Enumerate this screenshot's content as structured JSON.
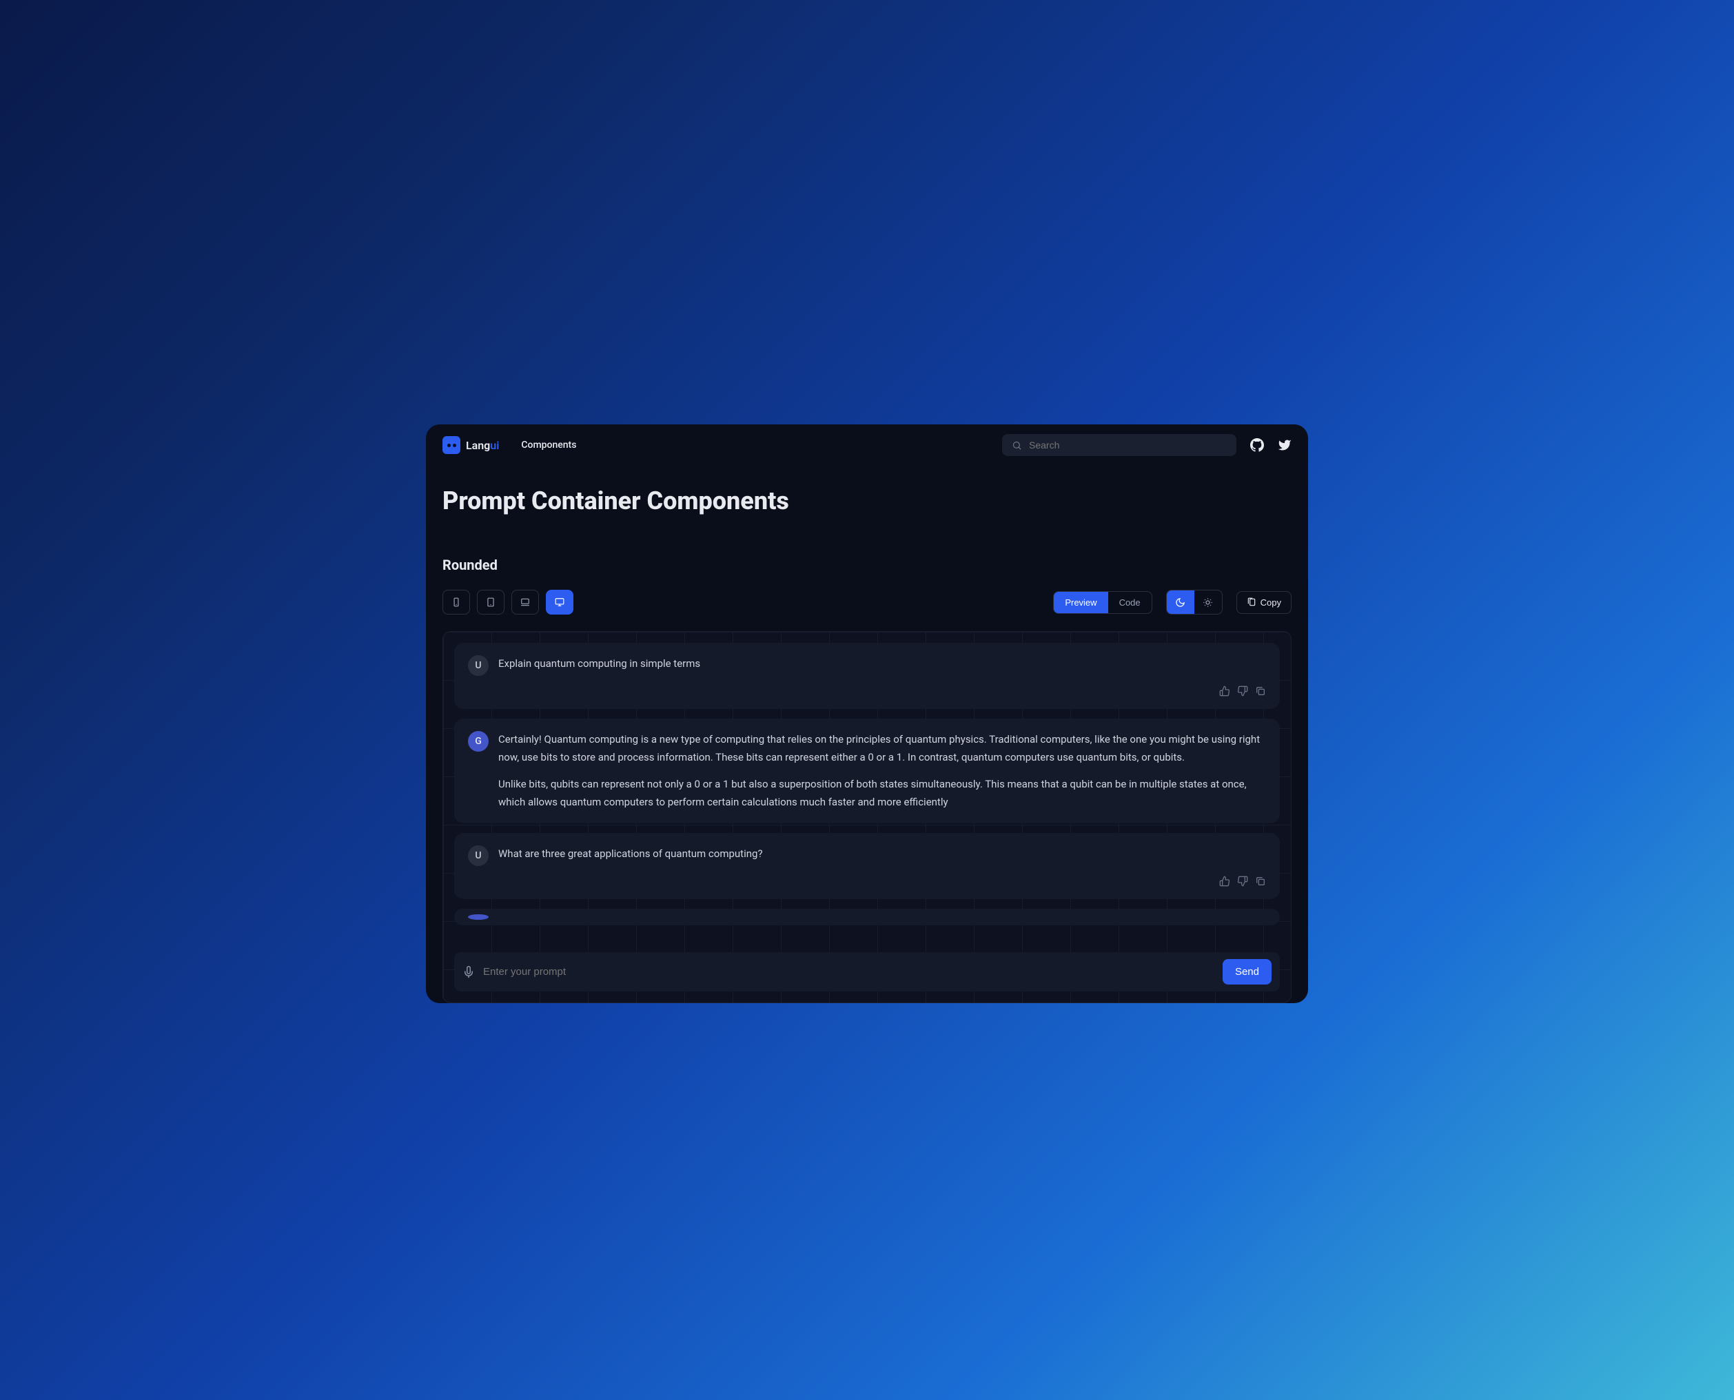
{
  "brand": {
    "name_a": "Lang",
    "name_b": "ui"
  },
  "nav": {
    "components": "Components"
  },
  "search": {
    "placeholder": "Search"
  },
  "page": {
    "title": "Prompt Container Components"
  },
  "section": {
    "title": "Rounded"
  },
  "controls": {
    "preview": "Preview",
    "code": "Code",
    "copy": "Copy"
  },
  "chat": {
    "messages": [
      {
        "role": "user",
        "avatar": "U",
        "text": "Explain quantum computing in simple terms"
      },
      {
        "role": "bot",
        "avatar": "G",
        "p1": "Certainly! Quantum computing is a new type of computing that relies on the principles of quantum physics. Traditional computers, like the one you might be using right now, use bits to store and process information. These bits can represent either a 0 or a 1. In contrast, quantum computers use quantum bits, or qubits.",
        "p2": "Unlike bits, qubits can represent not only a 0 or a 1 but also a superposition of both states simultaneously. This means that a qubit can be in multiple states at once, which allows quantum computers to perform certain calculations much faster and more efficiently"
      },
      {
        "role": "user",
        "avatar": "U",
        "text": "What are three great applications of quantum computing?"
      }
    ],
    "input_placeholder": "Enter your prompt",
    "send": "Send"
  }
}
